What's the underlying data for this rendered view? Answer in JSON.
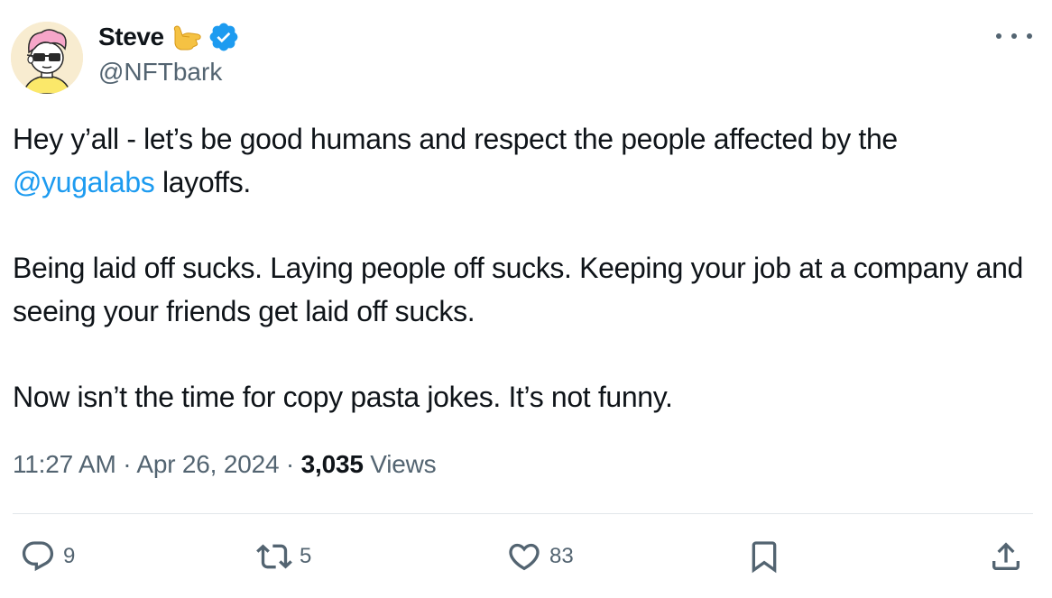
{
  "author": {
    "name": "Steve",
    "name_emoji": "call-me-hand-emoji",
    "verified_icon": "verified-badge-icon",
    "handle": "@NFTbark",
    "avatar": "avatar-cartoon-glasses"
  },
  "more_icon": "more-icon",
  "tweet": {
    "p1_part1": "Hey y’all - let’s be good humans and respect the people affected by the ",
    "p1_mention": "@yugalabs",
    "p1_part2": " layoffs.",
    "p2": "Being laid off sucks. Laying people off sucks. Keeping your job at a company and seeing your friends get laid off sucks.",
    "p3": "Now isn’t the time for copy pasta jokes. It’s not funny."
  },
  "meta": {
    "time": "11:27 AM",
    "sep1": " · ",
    "date": "Apr 26, 2024",
    "sep2": " · ",
    "views_count": "3,035",
    "views_label": " Views"
  },
  "actions": {
    "reply": {
      "icon": "reply-icon",
      "count": "9"
    },
    "retweet": {
      "icon": "retweet-icon",
      "count": "5"
    },
    "like": {
      "icon": "heart-icon",
      "count": "83"
    },
    "bookmark": {
      "icon": "bookmark-icon"
    },
    "share": {
      "icon": "share-icon"
    }
  },
  "colors": {
    "link": "#1d9bf0",
    "secondary_text": "#536471",
    "primary_text": "#0f1419",
    "divider": "#e1e6ea"
  }
}
